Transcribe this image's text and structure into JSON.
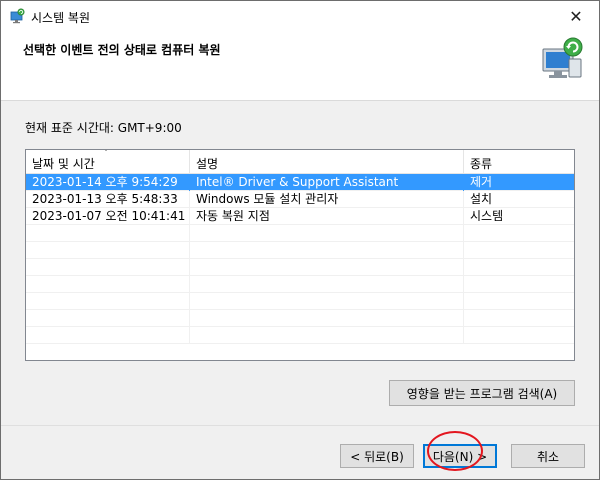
{
  "window": {
    "title": "시스템 복원",
    "close_glyph": "✕"
  },
  "header": {
    "title": "선택한 이벤트 전의 상태로 컴퓨터 복원"
  },
  "timezone_label": "현재 표준 시간대: GMT+9:00",
  "table": {
    "columns": [
      "날짜 및 시간",
      "설명",
      "종류"
    ],
    "sort_indicator": "ˇ",
    "rows": [
      {
        "datetime": "2023-01-14 오후 9:54:29",
        "description": "Intel® Driver & Support Assistant",
        "type": "제거",
        "selected": true
      },
      {
        "datetime": "2023-01-13 오후 5:48:33",
        "description": "Windows 모듈 설치 관리자",
        "type": "설치",
        "selected": false
      },
      {
        "datetime": "2023-01-07 오전 10:41:41",
        "description": "자동 복원 지점",
        "type": "시스템",
        "selected": false
      }
    ]
  },
  "buttons": {
    "affected_programs": "영향을 받는 프로그램 검색(A)",
    "back": "< 뒤로(B)",
    "next": "다음(N) >",
    "cancel": "취소"
  },
  "colors": {
    "selection": "#3399ff",
    "annotation": "#e3161f",
    "focus_border": "#0078d7"
  },
  "icons": {
    "title": "system-restore-icon",
    "header": "system-restore-computer-icon",
    "close": "close-icon"
  }
}
